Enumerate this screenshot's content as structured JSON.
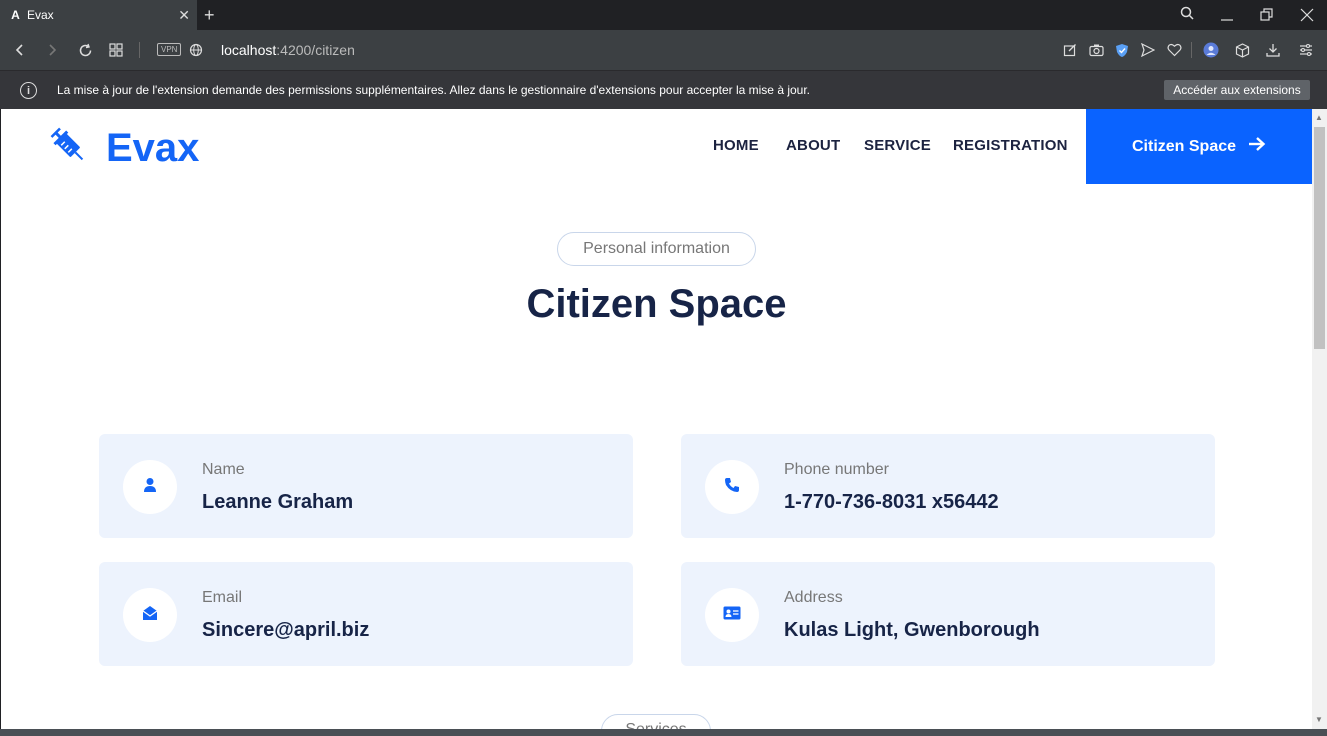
{
  "browser": {
    "tab_title": "Evax",
    "tab_favicon": "A",
    "url_host": "localhost",
    "url_path": ":4200/citizen",
    "vpn_label": "VPN",
    "infobar_message": "La mise à jour de l'extension demande des permissions supplémentaires. Allez dans le gestionnaire d'extensions pour accepter la mise à jour.",
    "infobar_button": "Accéder aux extensions"
  },
  "site": {
    "brand": "Evax",
    "brand_color": "#1465f6",
    "nav": [
      "HOME",
      "ABOUT",
      "SERVICE",
      "REGISTRATION"
    ],
    "cta_label": "Citizen Space",
    "cta_color": "#0a63ff"
  },
  "section": {
    "pill": "Personal information",
    "title": "Citizen Space",
    "next_pill": "Services"
  },
  "cards": [
    {
      "label": "Name",
      "value": "Leanne Graham",
      "icon": "user-icon"
    },
    {
      "label": "Phone number",
      "value": "1-770-736-8031 x56442",
      "icon": "phone-icon"
    },
    {
      "label": "Email",
      "value": "Sincere@april.biz",
      "icon": "envelope-icon"
    },
    {
      "label": "Address",
      "value": "Kulas Light, Gwenborough",
      "icon": "address-card-icon"
    }
  ]
}
